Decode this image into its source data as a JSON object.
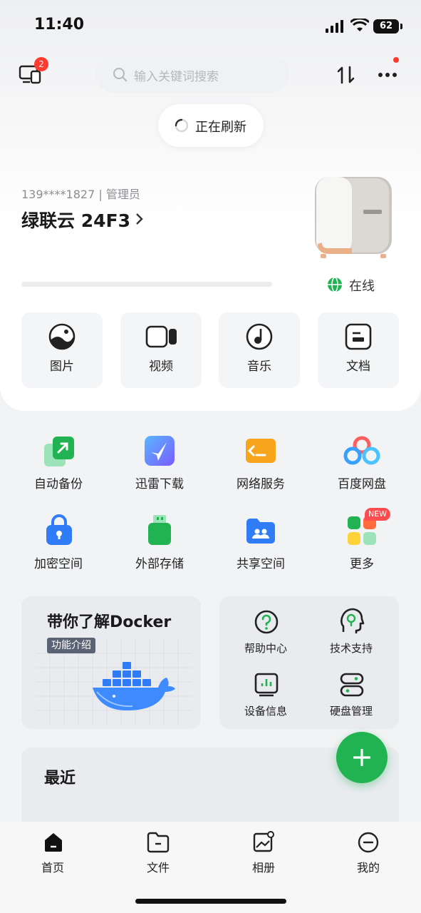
{
  "status_bar": {
    "time": "11:40",
    "battery": "62"
  },
  "header": {
    "device_badge_count": "2",
    "search_placeholder": "输入关键词搜索",
    "refresh_text": "正在刷新"
  },
  "device": {
    "account": "139****1827 | 管理员",
    "name": "绿联云 24F3",
    "status": "在线",
    "storage_used_fraction": 0
  },
  "categories": [
    {
      "label": "图片",
      "icon": "photo-icon"
    },
    {
      "label": "视频",
      "icon": "video-icon"
    },
    {
      "label": "音乐",
      "icon": "music-icon"
    },
    {
      "label": "文档",
      "icon": "document-icon"
    }
  ],
  "apps": [
    {
      "label": "自动备份",
      "icon": "backup-icon"
    },
    {
      "label": "迅雷下载",
      "icon": "thunder-download-icon"
    },
    {
      "label": "网络服务",
      "icon": "terminal-icon"
    },
    {
      "label": "百度网盘",
      "icon": "baidu-netdisk-icon"
    },
    {
      "label": "加密空间",
      "icon": "lock-icon"
    },
    {
      "label": "外部存储",
      "icon": "usb-drive-icon"
    },
    {
      "label": "共享空间",
      "icon": "shared-folder-icon"
    },
    {
      "label": "更多",
      "icon": "more-apps-icon",
      "badge": "NEW"
    }
  ],
  "docker_card": {
    "title": "带你了解Docker",
    "badge": "功能介绍"
  },
  "support": [
    {
      "label": "帮助中心",
      "icon": "help-icon"
    },
    {
      "label": "技术支持",
      "icon": "tech-support-icon"
    },
    {
      "label": "设备信息",
      "icon": "device-info-icon"
    },
    {
      "label": "硬盘管理",
      "icon": "disk-management-icon"
    }
  ],
  "recent": {
    "title": "最近"
  },
  "tabbar": [
    {
      "label": "首页",
      "icon": "home-icon",
      "active": true
    },
    {
      "label": "文件",
      "icon": "file-icon"
    },
    {
      "label": "相册",
      "icon": "album-icon"
    },
    {
      "label": "我的",
      "icon": "profile-icon"
    }
  ],
  "colors": {
    "accent": "#21b251",
    "badge": "#ff3b30"
  }
}
